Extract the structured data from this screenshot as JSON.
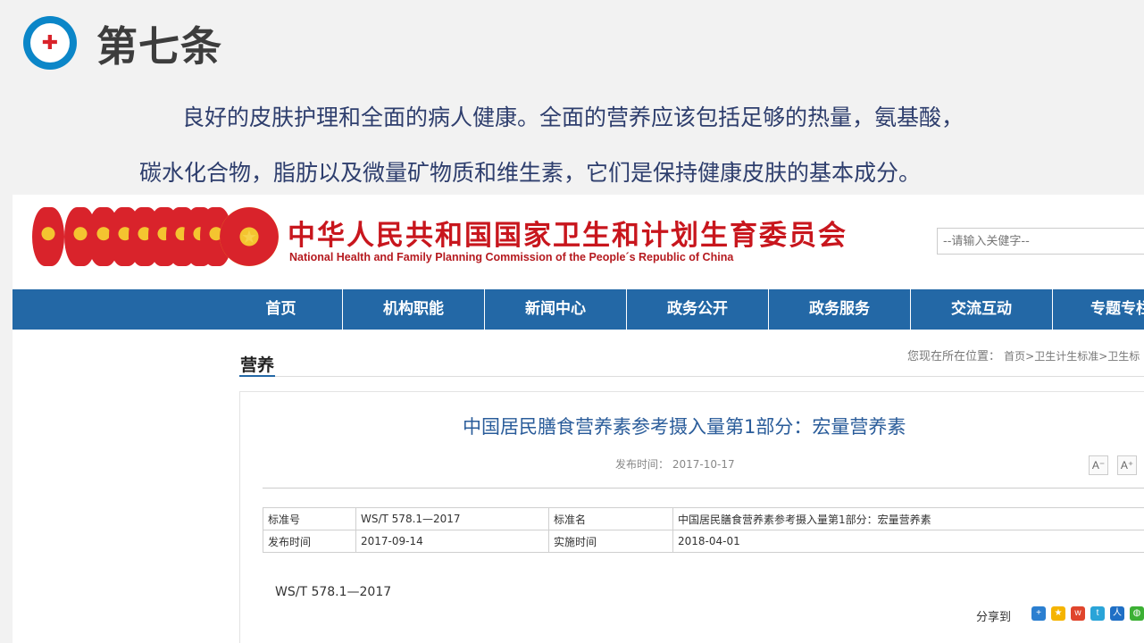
{
  "slide": {
    "title": "第七条",
    "para_line1": "良好的皮肤护理和全面的病人健康。全面的营养应该包括足够的热量，氨基酸，",
    "para_line2": "碳水化合物，脂肪以及微量矿物质和维生素，它们是保持健康皮肤的基本成分。"
  },
  "site": {
    "title_cn": "中华人民共和国国家卫生和计划生育委员会",
    "title_en": "National Health and Family Planning Commission of the People´s Republic of China",
    "search_placeholder": "--请输入关健字--",
    "nav": [
      "首页",
      "机构职能",
      "新闻中心",
      "政务公开",
      "政务服务",
      "交流互动",
      "专题专栏"
    ]
  },
  "section": {
    "title": "营养",
    "breadcrumb_label": "您现在所在位置：",
    "breadcrumb_path": "首页>卫生计生标准>卫生标"
  },
  "article": {
    "title": "中国居民膳食营养素参考摄入量第1部分：宏量营养素",
    "publish_label": "发布时间：",
    "publish_date": "2017-10-17",
    "font_smaller": "A⁻",
    "font_larger": "A⁺",
    "table": [
      [
        "标准号",
        "WS/T 578.1—2017",
        "标准名",
        "中国居民膳食营养素参考摄入量第1部分：宏量营养素"
      ],
      [
        "发布时间",
        "2017-09-14",
        "实施时间",
        "2018-04-01"
      ]
    ],
    "code": "WS/T 578.1—2017",
    "share_label": "分享到"
  },
  "share_icons": [
    "plus-icon",
    "qzone-icon",
    "weibo-icon",
    "tencent-weibo-icon",
    "renren-icon",
    "wechat-icon"
  ],
  "colors": {
    "nav_blue": "#2368a6",
    "title_red": "#c8161d",
    "article_title": "#2a5c9a",
    "slide_text": "#2e3e6d"
  }
}
